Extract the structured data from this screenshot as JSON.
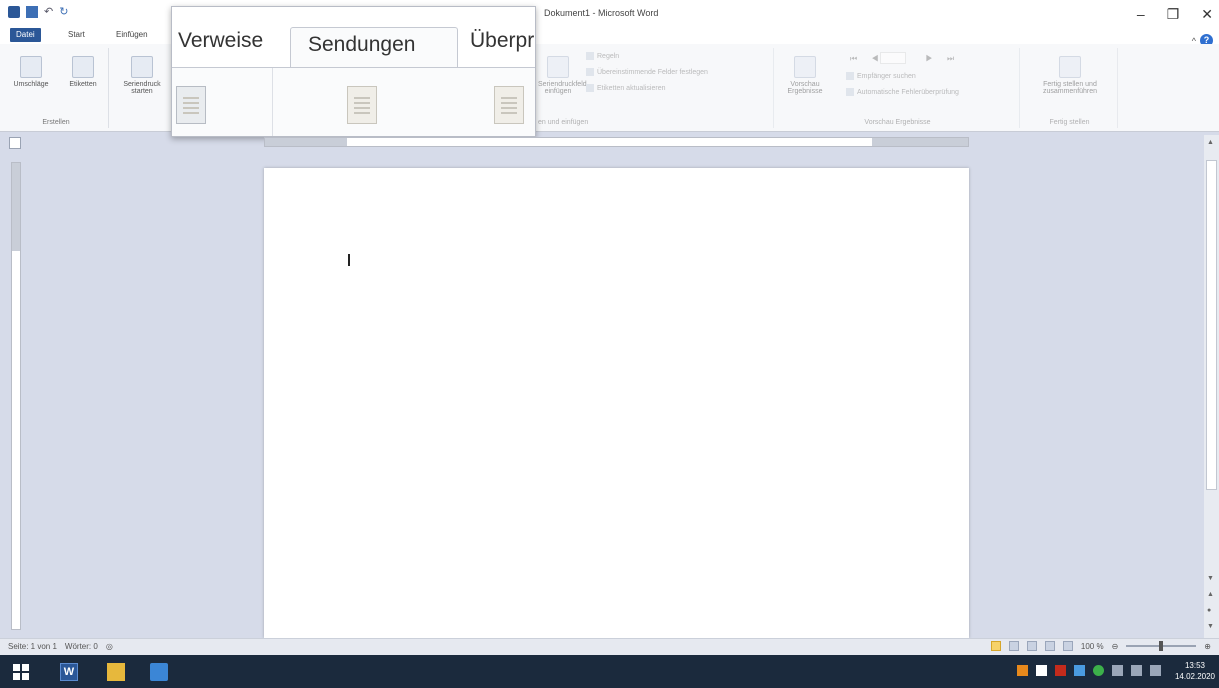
{
  "window": {
    "title": "Dokument1 - Microsoft Word",
    "controls": {
      "minimize": "–",
      "restore": "❐",
      "close": "✕"
    }
  },
  "tabs": {
    "file": "Datei",
    "start": "Start",
    "insert": "Einfügen"
  },
  "magnifier": {
    "tabs": [
      "Verweise",
      "Sendungen",
      "Überpr"
    ],
    "selected": "Sendungen"
  },
  "ribbon": {
    "create_group": {
      "label": "Erstellen",
      "envelopes": "Umschläge",
      "labels": "Etiketten"
    },
    "merge_button": "Seriendruck starten",
    "merge_group_label": "en und einfügen",
    "insert_field": "Seriendruckfeld einfügen",
    "rules": "Regeln",
    "match_fields": "Übereinstimmende Felder festlegen",
    "update_labels": "Etiketten aktualisieren",
    "preview": {
      "button": "Vorschau Ergebnisse",
      "find_recipient": "Empfänger suchen",
      "auto_check": "Automatische Fehlerüberprüfung",
      "label": "Vorschau Ergebnisse"
    },
    "finish": {
      "button": "Fertig stellen und zusammenführen",
      "label": "Fertig stellen"
    }
  },
  "status": {
    "page": "Seite: 1 von 1",
    "words": "Wörter: 0",
    "zoom": "100 %"
  },
  "taskbar": {
    "time": "13:53",
    "date": "14.02.2020"
  }
}
